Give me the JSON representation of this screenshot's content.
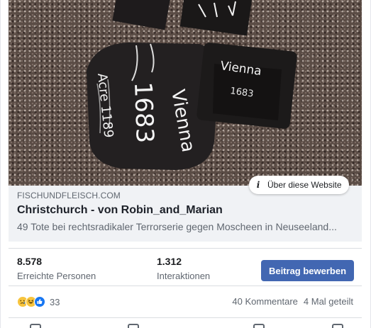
{
  "photo": {
    "labels": {
      "vienna": "Vienna",
      "year_big": "1683",
      "acre": "Acre 1189",
      "vienna_small": "Vienna",
      "year_small": "1683"
    }
  },
  "website_chip": {
    "icon": "info-icon",
    "label": "Über diese Website"
  },
  "link_preview": {
    "domain": "FISCHUNDFLEISCH.COM",
    "title": "Christchurch - von Robin_and_Marian",
    "description": "49 Tote bei rechtsradikaler Terrorserie gegen Moscheen in Neuseeland..."
  },
  "stats": {
    "reach": {
      "value": "8.578",
      "label": "Erreichte Personen"
    },
    "interactions": {
      "value": "1.312",
      "label": "Interaktionen"
    },
    "boost_button": "Beitrag bewerben",
    "boost_color": "#4267b2"
  },
  "reactions": {
    "icons": [
      "sad-reaction-icon",
      "haha-reaction-icon",
      "like-reaction-icon"
    ],
    "count": "33",
    "comments": "40 Kommentare",
    "shares": "4 Mal geteilt"
  }
}
